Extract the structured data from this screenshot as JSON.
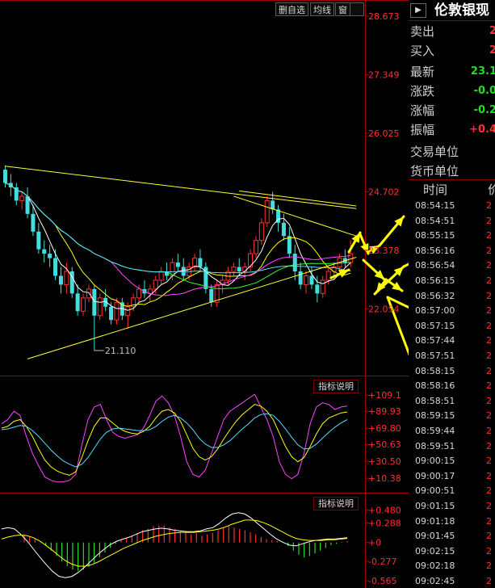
{
  "toolbar": {
    "btn_delete_self": "删自选",
    "btn_ma": "均线",
    "btn_window": "窗"
  },
  "indicator_panels": {
    "panel2_label": "指标说明",
    "panel3_label": "指标说明"
  },
  "quote": {
    "title": "伦敦银现",
    "rows": [
      {
        "label": "卖出",
        "value": "2",
        "color": "#ff3030"
      },
      {
        "label": "买入",
        "value": "2",
        "color": "#ff3030"
      },
      {
        "label": "最新",
        "value": "23.1",
        "color": "#22dd22"
      },
      {
        "label": "涨跌",
        "value": "-0.0",
        "color": "#22dd22"
      },
      {
        "label": "涨幅",
        "value": "-0.2",
        "color": "#22dd22"
      },
      {
        "label": "振幅",
        "value": "+0.4",
        "color": "#ff3030"
      },
      {
        "label": "交易单位",
        "value": "",
        "color": "#d0d0d0"
      },
      {
        "label": "货币单位",
        "value": "",
        "color": "#d0d0d0"
      }
    ],
    "tick_header_time": "时间",
    "tick_header_price": "价",
    "ticks": [
      {
        "time": "08:54:15",
        "price": "2"
      },
      {
        "time": "08:54:51",
        "price": "2"
      },
      {
        "time": "08:55:15",
        "price": "2"
      },
      {
        "time": "08:56:16",
        "price": "2"
      },
      {
        "time": "08:56:54",
        "price": "2"
      },
      {
        "time": "08:56:15",
        "price": "2"
      },
      {
        "time": "08:56:32",
        "price": "2"
      },
      {
        "time": "08:57:00",
        "price": "2"
      },
      {
        "time": "08:57:15",
        "price": "2"
      },
      {
        "time": "08:57:44",
        "price": "2"
      },
      {
        "time": "08:57:51",
        "price": "2"
      },
      {
        "time": "08:58:15",
        "price": "2"
      },
      {
        "time": "08:58:16",
        "price": "2"
      },
      {
        "time": "08:58:51",
        "price": "2"
      },
      {
        "time": "08:59:15",
        "price": "2"
      },
      {
        "time": "08:59:44",
        "price": "2"
      },
      {
        "time": "08:59:51",
        "price": "2"
      },
      {
        "time": "09:00:15",
        "price": "2"
      },
      {
        "time": "09:00:17",
        "price": "2"
      },
      {
        "time": "09:00:51",
        "price": "2"
      },
      {
        "time": "09:01:15",
        "price": "2"
      },
      {
        "time": "09:01:18",
        "price": "2"
      },
      {
        "time": "09:01:45",
        "price": "2"
      },
      {
        "time": "09:02:15",
        "price": "2"
      },
      {
        "time": "09:02:18",
        "price": "2"
      },
      {
        "time": "09:02:45",
        "price": "2"
      }
    ]
  },
  "chart_data": [
    {
      "type": "candlestick",
      "panel": "price",
      "ylim": [
        21.0,
        28.673
      ],
      "y_ticks": [
        {
          "value": 28.673,
          "label": "28.673"
        },
        {
          "value": 27.349,
          "label": "27.349"
        },
        {
          "value": 26.025,
          "label": "26.025"
        },
        {
          "value": 24.702,
          "label": "24.702"
        },
        {
          "value": 23.378,
          "label": "23.378"
        },
        {
          "value": 22.054,
          "label": "22.054"
        }
      ],
      "low_annotation": {
        "value": 21.11,
        "label": "21.110",
        "bar_index": 16
      },
      "candles": [
        [
          25.2,
          25.3,
          24.8,
          24.9
        ],
        [
          24.9,
          25.1,
          24.6,
          24.8
        ],
        [
          24.8,
          24.9,
          24.4,
          24.5
        ],
        [
          24.5,
          24.7,
          24.3,
          24.6
        ],
        [
          24.6,
          24.8,
          24.1,
          24.2
        ],
        [
          24.2,
          24.4,
          23.7,
          23.8
        ],
        [
          23.8,
          24.0,
          23.3,
          23.4
        ],
        [
          23.4,
          23.6,
          23.1,
          23.3
        ],
        [
          23.3,
          23.5,
          23.0,
          23.2
        ],
        [
          23.2,
          23.4,
          22.7,
          22.8
        ],
        [
          22.8,
          23.0,
          22.4,
          22.6
        ],
        [
          22.6,
          23.1,
          22.4,
          22.9
        ],
        [
          22.9,
          23.0,
          22.3,
          22.4
        ],
        [
          22.4,
          22.6,
          21.9,
          22.0
        ],
        [
          22.0,
          22.4,
          21.9,
          22.3
        ],
        [
          22.3,
          22.6,
          22.2,
          22.5
        ],
        [
          22.5,
          22.6,
          21.1,
          21.9
        ],
        [
          21.9,
          22.4,
          21.8,
          22.3
        ],
        [
          22.3,
          22.5,
          22.0,
          22.1
        ],
        [
          22.1,
          22.2,
          21.7,
          21.8
        ],
        [
          21.8,
          22.3,
          21.7,
          22.2
        ],
        [
          22.2,
          22.3,
          21.8,
          21.9
        ],
        [
          21.9,
          22.2,
          21.6,
          22.1
        ],
        [
          22.1,
          22.4,
          22.0,
          22.3
        ],
        [
          22.3,
          22.6,
          22.2,
          22.5
        ],
        [
          22.5,
          22.7,
          22.3,
          22.4
        ],
        [
          22.4,
          22.6,
          22.2,
          22.5
        ],
        [
          22.5,
          22.8,
          22.4,
          22.7
        ],
        [
          22.7,
          23.0,
          22.6,
          22.9
        ],
        [
          22.9,
          23.1,
          22.7,
          22.8
        ],
        [
          22.8,
          23.2,
          22.7,
          23.1
        ],
        [
          23.1,
          23.3,
          22.9,
          23.0
        ],
        [
          23.0,
          23.2,
          22.7,
          22.8
        ],
        [
          22.8,
          23.1,
          22.7,
          23.0
        ],
        [
          23.0,
          23.3,
          22.9,
          23.2
        ],
        [
          23.2,
          23.4,
          22.9,
          23.0
        ],
        [
          23.0,
          23.1,
          22.4,
          22.5
        ],
        [
          22.5,
          22.6,
          22.1,
          22.2
        ],
        [
          22.2,
          22.7,
          22.1,
          22.6
        ],
        [
          22.6,
          22.8,
          22.4,
          22.7
        ],
        [
          22.7,
          23.0,
          22.6,
          22.9
        ],
        [
          22.9,
          23.1,
          22.8,
          23.0
        ],
        [
          23.0,
          23.2,
          22.8,
          22.9
        ],
        [
          22.9,
          23.1,
          22.7,
          23.0
        ],
        [
          23.0,
          23.4,
          22.9,
          23.3
        ],
        [
          23.3,
          23.7,
          23.2,
          23.6
        ],
        [
          23.6,
          24.1,
          23.5,
          24.0
        ],
        [
          24.0,
          24.6,
          23.9,
          24.5
        ],
        [
          24.5,
          24.7,
          24.2,
          24.3
        ],
        [
          24.3,
          24.4,
          23.8,
          24.0
        ],
        [
          24.0,
          24.2,
          23.6,
          23.7
        ],
        [
          23.7,
          23.9,
          23.2,
          23.3
        ],
        [
          23.3,
          23.5,
          22.7,
          22.9
        ],
        [
          22.9,
          23.1,
          22.5,
          22.6
        ],
        [
          22.6,
          22.9,
          22.4,
          22.8
        ],
        [
          22.8,
          23.0,
          22.5,
          22.6
        ],
        [
          22.6,
          22.8,
          22.2,
          22.4
        ],
        [
          22.4,
          22.8,
          22.3,
          22.7
        ],
        [
          22.7,
          23.0,
          22.6,
          22.9
        ],
        [
          22.9,
          23.1,
          22.7,
          23.0
        ],
        [
          23.0,
          23.3,
          22.9,
          23.2
        ],
        [
          23.2,
          23.4,
          23.0,
          23.1
        ],
        [
          23.1,
          23.6,
          23.0,
          23.3
        ]
      ],
      "trendlines": [
        {
          "from": [
            0,
            25.28
          ],
          "to": [
            63,
            24.32
          ]
        },
        {
          "from": [
            42,
            24.72
          ],
          "to": [
            63,
            24.38
          ]
        },
        {
          "from": [
            41,
            24.6
          ],
          "to": [
            63,
            23.7
          ]
        },
        {
          "from": [
            4,
            20.92
          ],
          "to": [
            63,
            23.22
          ]
        }
      ],
      "moving_averages": [
        {
          "color": "#ffffff",
          "period": 5
        },
        {
          "color": "#ffff00",
          "period": 10
        },
        {
          "color": "#ff44ff",
          "period": 20
        },
        {
          "color": "#33ff33",
          "period": 30
        },
        {
          "color": "#55ddff",
          "period": 60
        }
      ]
    },
    {
      "type": "line",
      "panel": "kdj",
      "ylim": [
        0,
        115
      ],
      "y_ticks": [
        {
          "value": 109.1,
          "label": "+109.1"
        },
        {
          "value": 89.93,
          "label": "+89.93"
        },
        {
          "value": 69.8,
          "label": "+69.80"
        },
        {
          "value": 50.63,
          "label": "+50.63"
        },
        {
          "value": 30.5,
          "label": "+30.50"
        },
        {
          "value": 10.38,
          "label": "+10.38"
        }
      ],
      "series": [
        {
          "color": "#ff44ff",
          "values": [
            75,
            80,
            90,
            85,
            60,
            40,
            25,
            12,
            8,
            6,
            6,
            8,
            15,
            50,
            80,
            95,
            98,
            80,
            65,
            60,
            58,
            60,
            62,
            70,
            85,
            102,
            108,
            100,
            85,
            60,
            30,
            15,
            12,
            20,
            40,
            60,
            80,
            90,
            95,
            100,
            105,
            110,
            95,
            80,
            60,
            30,
            15,
            10,
            15,
            40,
            75,
            95,
            100,
            98,
            92,
            95,
            96
          ]
        },
        {
          "color": "#ffff00",
          "values": [
            70,
            72,
            78,
            80,
            72,
            60,
            45,
            32,
            24,
            19,
            16,
            14,
            18,
            35,
            55,
            72,
            82,
            82,
            76,
            70,
            66,
            64,
            63,
            66,
            72,
            82,
            90,
            92,
            88,
            78,
            62,
            46,
            36,
            32,
            36,
            45,
            57,
            68,
            78,
            86,
            92,
            98,
            96,
            90,
            80,
            64,
            48,
            36,
            30,
            35,
            48,
            63,
            75,
            82,
            85,
            88,
            89
          ]
        },
        {
          "color": "#55ddff",
          "values": [
            68,
            69,
            71,
            73,
            72,
            67,
            60,
            52,
            44,
            37,
            31,
            27,
            24,
            27,
            35,
            46,
            57,
            65,
            69,
            70,
            69,
            68,
            67,
            67,
            68,
            72,
            78,
            83,
            85,
            82,
            76,
            68,
            58,
            51,
            47,
            47,
            50,
            55,
            62,
            69,
            75,
            82,
            86,
            87,
            85,
            78,
            69,
            59,
            50,
            45,
            46,
            51,
            58,
            65,
            71,
            76,
            80
          ]
        }
      ]
    },
    {
      "type": "bar",
      "panel": "macd",
      "ylim": [
        -0.6,
        0.52
      ],
      "y_ticks": [
        {
          "value": 0.48,
          "label": "+0.480"
        },
        {
          "value": 0.288,
          "label": "+0.288"
        },
        {
          "value": 0,
          "label": "+0"
        },
        {
          "value": -0.277,
          "label": "-0.277"
        },
        {
          "value": -0.565,
          "label": "-0.565"
        }
      ],
      "histogram": [
        0.12,
        0.09,
        0.05,
        0.01,
        -0.05,
        -0.12,
        -0.2,
        -0.28,
        -0.35,
        -0.4,
        -0.42,
        -0.4,
        -0.36,
        -0.3,
        -0.22,
        -0.15,
        -0.08,
        -0.02,
        0.03,
        0.06,
        0.1,
        0.14,
        0.18,
        0.2,
        0.24,
        0.25,
        0.25,
        0.22,
        0.2,
        0.16,
        0.14,
        0.12,
        0.14,
        0.1,
        0.12,
        0.14,
        0.18,
        0.22,
        0.24,
        0.22,
        0.2,
        0.18,
        0.15,
        0.12,
        0.08,
        0.05,
        0.03,
        0.02,
        0.01,
        -0.05,
        -0.12,
        -0.18,
        -0.22,
        -0.2,
        -0.16,
        -0.12,
        -0.08,
        -0.04,
        -0.02,
        0.01,
        0.02
      ],
      "series": [
        {
          "color": "#ffffff",
          "values": [
            0.2,
            0.22,
            0.2,
            0.12,
            0.02,
            -0.1,
            -0.22,
            -0.33,
            -0.43,
            -0.5,
            -0.52,
            -0.5,
            -0.44,
            -0.36,
            -0.27,
            -0.18,
            -0.1,
            -0.03,
            0.02,
            0.05,
            0.08,
            0.12,
            0.16,
            0.18,
            0.2,
            0.21,
            0.2,
            0.18,
            0.17,
            0.16,
            0.16,
            0.17,
            0.2,
            0.22,
            0.28,
            0.36,
            0.42,
            0.44,
            0.42,
            0.36,
            0.28,
            0.2,
            0.12,
            0.05,
            0.0,
            -0.04,
            -0.05,
            -0.02,
            0.01,
            0.03,
            0.04,
            0.05,
            0.05,
            0.06,
            0.07
          ]
        },
        {
          "color": "#ffff00",
          "values": [
            0.05,
            0.08,
            0.1,
            0.11,
            0.1,
            0.07,
            0.02,
            -0.05,
            -0.12,
            -0.2,
            -0.27,
            -0.32,
            -0.35,
            -0.35,
            -0.33,
            -0.29,
            -0.24,
            -0.19,
            -0.14,
            -0.09,
            -0.05,
            -0.01,
            0.03,
            0.06,
            0.09,
            0.11,
            0.13,
            0.14,
            0.15,
            0.15,
            0.15,
            0.16,
            0.17,
            0.18,
            0.2,
            0.23,
            0.27,
            0.3,
            0.33,
            0.33,
            0.32,
            0.29,
            0.25,
            0.2,
            0.15,
            0.1,
            0.06,
            0.04,
            0.03,
            0.03,
            0.03,
            0.04,
            0.04,
            0.05,
            0.06
          ]
        }
      ]
    }
  ]
}
